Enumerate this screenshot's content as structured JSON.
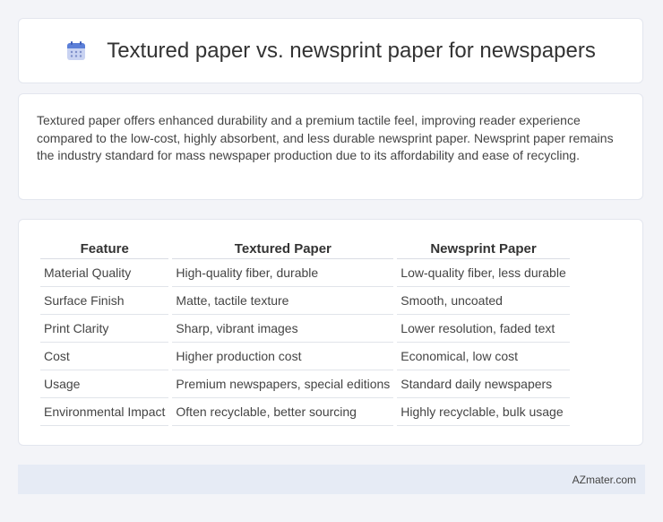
{
  "header": {
    "title": "Textured paper vs. newsprint paper for newspapers",
    "icon": "calendar-icon"
  },
  "intro": {
    "text": "Textured paper offers enhanced durability and a premium tactile feel, improving reader experience compared to the low-cost, highly absorbent, and less durable newsprint paper. Newsprint paper remains the industry standard for mass newspaper production due to its affordability and ease of recycling."
  },
  "table": {
    "headers": [
      "Feature",
      "Textured Paper",
      "Newsprint Paper"
    ],
    "rows": [
      [
        "Material Quality",
        "High-quality fiber, durable",
        "Low-quality fiber, less durable"
      ],
      [
        "Surface Finish",
        "Matte, tactile texture",
        "Smooth, uncoated"
      ],
      [
        "Print Clarity",
        "Sharp, vibrant images",
        "Lower resolution, faded text"
      ],
      [
        "Cost",
        "Higher production cost",
        "Economical, low cost"
      ],
      [
        "Usage",
        "Premium newspapers, special editions",
        "Standard daily newspapers"
      ],
      [
        "Environmental Impact",
        "Often recyclable, better sourcing",
        "Highly recyclable, bulk usage"
      ]
    ]
  },
  "footer": {
    "brand": "AZmater.com"
  },
  "colors": {
    "background": "#f3f4f8",
    "card": "#ffffff",
    "footer": "#e6ebf5",
    "icon_top": "#5b7fd8",
    "icon_body": "#b9c6ef"
  }
}
